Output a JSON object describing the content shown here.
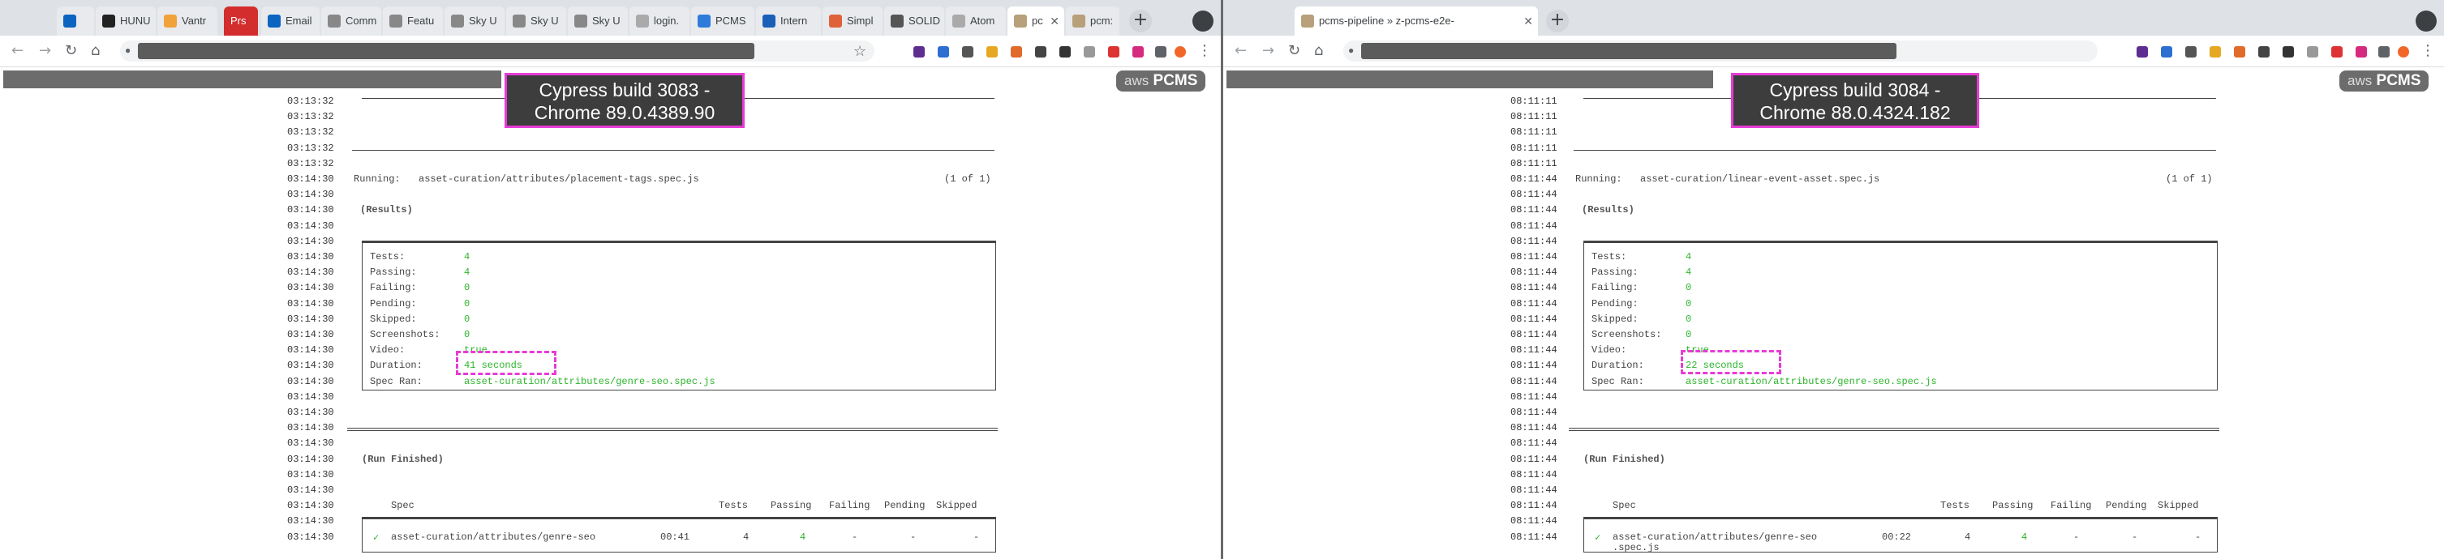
{
  "left": {
    "tabs": [
      "",
      "HUNU",
      "Vantr",
      "Prs",
      "Email",
      "Comm",
      "Featu",
      "Sky U",
      "Sky U",
      "Sky U",
      "login.",
      "PCMS",
      "Intern",
      "Simpl",
      "SOLID",
      "Atom",
      "pc",
      "pcm:"
    ],
    "overlay_title": "Cypress build 3083 -\nChrome 89.0.4389.90",
    "badge": {
      "aws": "aws",
      "product": "PCMS"
    },
    "ts_header": "03:13:32",
    "ts_main": "03:14:30",
    "running_label": "Running:",
    "running_spec": "asset-curation/attributes/placement-tags.spec.js",
    "running_count": "(1 of 1)",
    "results_label": "(Results)",
    "stats": [
      {
        "k": "Tests:",
        "v": "4"
      },
      {
        "k": "Passing:",
        "v": "4"
      },
      {
        "k": "Failing:",
        "v": "0"
      },
      {
        "k": "Pending:",
        "v": "0"
      },
      {
        "k": "Skipped:",
        "v": "0"
      },
      {
        "k": "Screenshots:",
        "v": "0"
      },
      {
        "k": "Video:",
        "v": "true"
      },
      {
        "k": "Duration:",
        "v": "41 seconds"
      },
      {
        "k": "Spec Ran:",
        "v": "asset-curation/attributes/genre-seo.spec.js"
      }
    ],
    "run_finished_label": "(Run Finished)",
    "table_headers": [
      "Spec",
      "Tests",
      "Passing",
      "Failing",
      "Pending",
      "Skipped"
    ],
    "row": {
      "check": "✓",
      "spec": "asset-curation/attributes/genre-seo",
      "time": "00:41",
      "tests": "4",
      "passing": "4",
      "failing": "-",
      "pending": "-",
      "skipped": "-"
    }
  },
  "right": {
    "tabs": [
      "pcms-pipeline » z-pcms-e2e-"
    ],
    "overlay_title": "Cypress build 3084 -\nChrome 88.0.4324.182",
    "badge": {
      "aws": "aws",
      "product": "PCMS"
    },
    "ts_header": "08:11:11",
    "ts_main": "08:11:44",
    "running_label": "Running:",
    "running_spec": "asset-curation/linear-event-asset.spec.js",
    "running_count": "(1 of 1)",
    "results_label": "(Results)",
    "stats": [
      {
        "k": "Tests:",
        "v": "4"
      },
      {
        "k": "Passing:",
        "v": "4"
      },
      {
        "k": "Failing:",
        "v": "0"
      },
      {
        "k": "Pending:",
        "v": "0"
      },
      {
        "k": "Skipped:",
        "v": "0"
      },
      {
        "k": "Screenshots:",
        "v": "0"
      },
      {
        "k": "Video:",
        "v": "true"
      },
      {
        "k": "Duration:",
        "v": "22 seconds"
      },
      {
        "k": "Spec Ran:",
        "v": "asset-curation/attributes/genre-seo.spec.js"
      }
    ],
    "run_finished_label": "(Run Finished)",
    "table_headers": [
      "Spec",
      "Tests",
      "Passing",
      "Failing",
      "Pending",
      "Skipped"
    ],
    "row": {
      "check": "✓",
      "spec": "asset-curation/attributes/genre-seo",
      "time": "00:22",
      "tests": "4",
      "passing": "4",
      "failing": "-",
      "pending": "-",
      "skipped": "-"
    },
    "row_wrap": ".spec.js"
  }
}
